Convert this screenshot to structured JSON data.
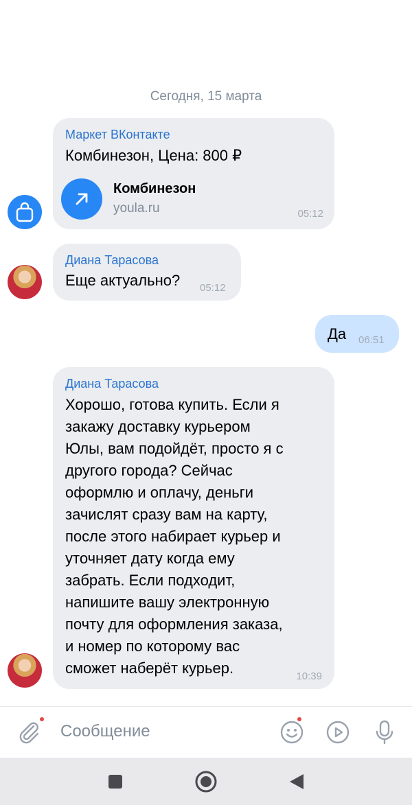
{
  "chat": {
    "date_separator": "Сегодня, 15 марта",
    "messages": [
      {
        "sender": "Маркет ВКонтакте",
        "text": "Комбинезон, Цена: 800 ₽",
        "link": {
          "title": "Комбинезон",
          "domain": "youla.ru",
          "icon": "arrow-up-right-icon"
        },
        "time": "05:12",
        "avatar_icon": "shopping-bag-icon"
      },
      {
        "sender": "Диана Тарасова",
        "text": "Еще актуально?",
        "time": "05:12"
      },
      {
        "outgoing": true,
        "text": "Да",
        "time": "06:51"
      },
      {
        "sender": "Диана Тарасова",
        "lines": [
          "Хорошо, готова купить. Если я",
          "закажу доставку курьером",
          "Юлы, вам подойдёт, просто я с",
          "другого города? Сейчас",
          "оформлю и оплачу, деньги",
          "зачислят сразу вам на карту,",
          "после этого набирает курьер и",
          "уточняет дату когда ему",
          "забрать. Если подходит,",
          "напишите вашу электронную",
          "почту для оформления заказа,",
          "и номер по которому вас",
          "сможет наберёт курьер."
        ],
        "time": "10:39"
      }
    ]
  },
  "composer": {
    "placeholder": "Сообщение",
    "icons": [
      "paperclip-icon",
      "emoji-icon",
      "play-circle-icon",
      "microphone-icon"
    ]
  },
  "nav": {
    "icons": [
      "recents-square-icon",
      "home-circle-icon",
      "back-triangle-icon"
    ]
  },
  "colors": {
    "accent": "#2787f5",
    "sender_name": "#2a74d0",
    "incoming_bubble": "#ebedf0",
    "outgoing_bubble": "#cce4ff",
    "badge": "#e64646"
  }
}
